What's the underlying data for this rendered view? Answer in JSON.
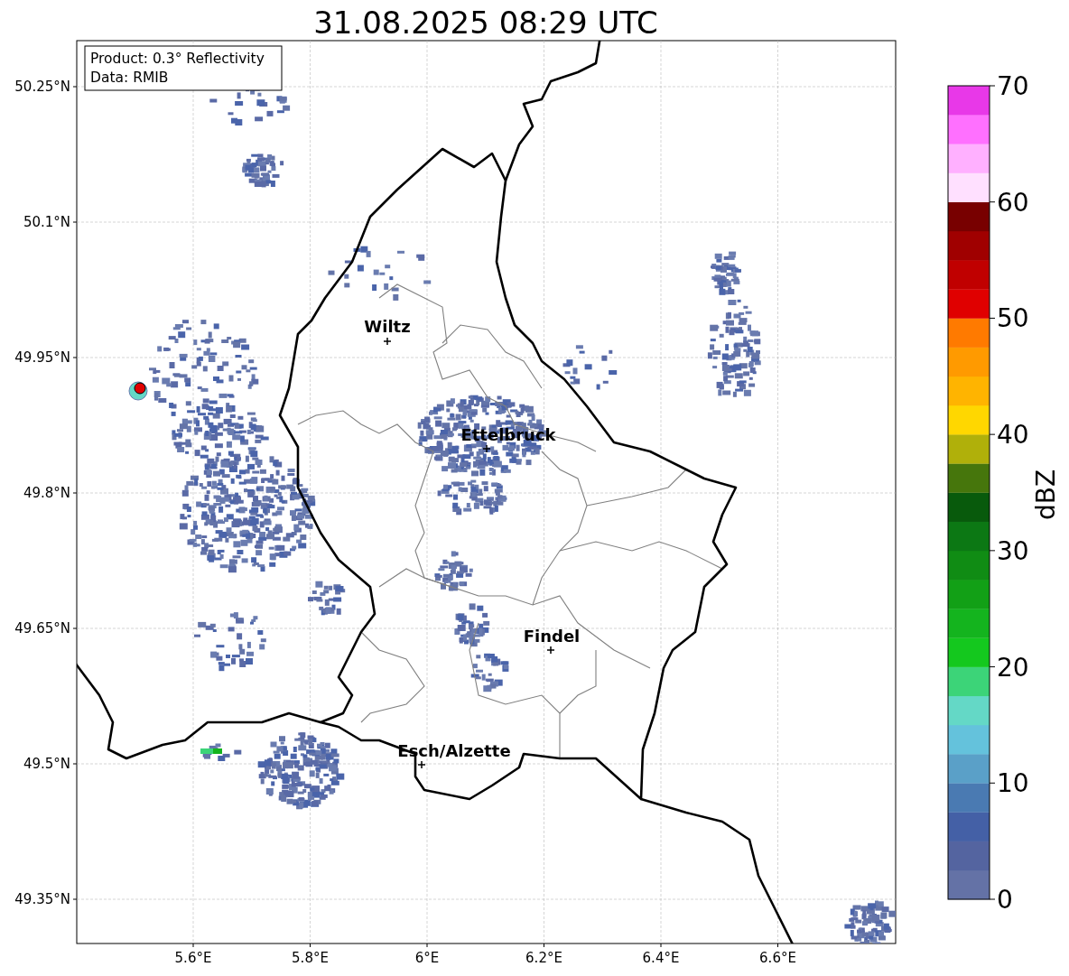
{
  "title": "31.08.2025 08:29 UTC",
  "info_box": [
    "Product: 0.3° Reflectivity",
    "Data: RMIB"
  ],
  "cities": [
    {
      "name": "Wiltz"
    },
    {
      "name": "Ettelbruck"
    },
    {
      "name": "Findel"
    },
    {
      "name": "Esch/Alzette"
    }
  ],
  "x_ticks": [
    "5.6°E",
    "5.8°E",
    "6°E",
    "6.2°E",
    "6.4°E",
    "6.6°E"
  ],
  "y_ticks": [
    "50.25°N",
    "50.1°N",
    "49.95°N",
    "49.8°N",
    "49.65°N",
    "49.5°N",
    "49.35°N"
  ],
  "colorbar": {
    "label": "dBZ",
    "ticks": [
      "70",
      "60",
      "50",
      "40",
      "30",
      "20",
      "10",
      "0"
    ],
    "bins": [
      {
        "color": "#6472a6"
      },
      {
        "color": "#5464a0"
      },
      {
        "color": "#4460a6"
      },
      {
        "color": "#4a7ab2"
      },
      {
        "color": "#5aa0c8"
      },
      {
        "color": "#64c2dc"
      },
      {
        "color": "#64d8c6"
      },
      {
        "color": "#3cd478"
      },
      {
        "color": "#14c81e"
      },
      {
        "color": "#14b41e"
      },
      {
        "color": "#12a016"
      },
      {
        "color": "#108c14"
      },
      {
        "color": "#0c7814"
      },
      {
        "color": "#085a0c"
      },
      {
        "color": "#46760c"
      },
      {
        "color": "#b0b00a"
      },
      {
        "color": "#ffd700"
      },
      {
        "color": "#ffb400"
      },
      {
        "color": "#ff9a00"
      },
      {
        "color": "#ff7a00"
      },
      {
        "color": "#e00000"
      },
      {
        "color": "#c00000"
      },
      {
        "color": "#a00000"
      },
      {
        "color": "#780000"
      },
      {
        "color": "#ffe0ff"
      },
      {
        "color": "#ffb0ff"
      },
      {
        "color": "#ff70ff"
      },
      {
        "color": "#e838e8"
      }
    ]
  }
}
